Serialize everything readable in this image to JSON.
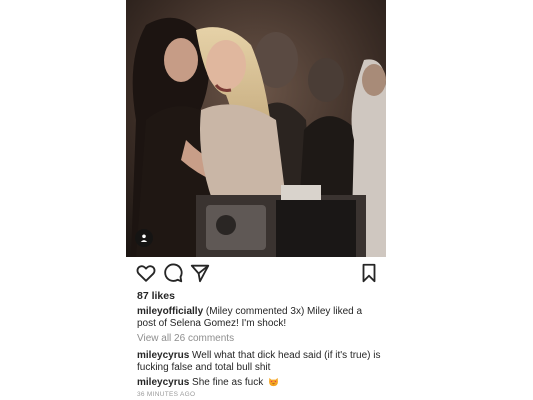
{
  "post": {
    "likes": "87 likes",
    "caption": {
      "username": "mileyofficially",
      "text": " (Miley commented 3x)  Miley liked a post of Selena Gomez! I'm shock!"
    },
    "view_all_comments": "View all 26 comments",
    "comments": [
      {
        "username": "mileycyrus",
        "text": " Well what that dick head said (if it's true) is fucking false and total bull shit"
      },
      {
        "username": "mileycyrus",
        "text": " She  fine as fuck "
      }
    ],
    "timestamp": "36 MINUTES AGO"
  },
  "icons": {
    "tag": "person-tag-icon",
    "like": "heart-icon",
    "comment": "speech-bubble-icon",
    "share": "paper-plane-icon",
    "save": "bookmark-icon",
    "emoji": "heart-eyes-cat-emoji"
  }
}
